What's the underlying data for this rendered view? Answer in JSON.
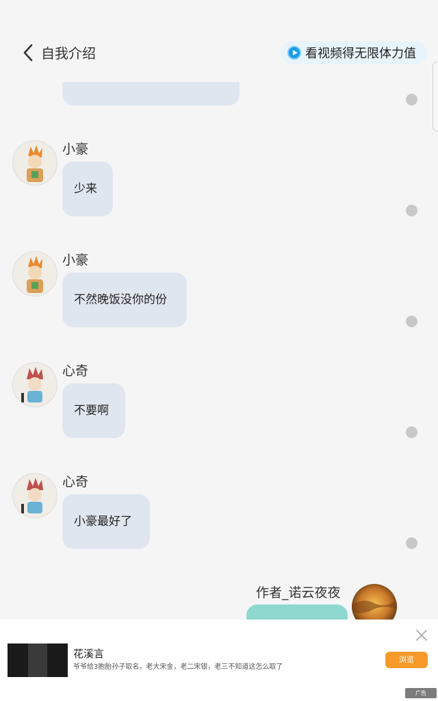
{
  "header": {
    "back_icon": "chevron-left-icon",
    "title": "自我介绍",
    "video_reward_label": "看视频得无限体力值",
    "play_icon": "play-circle-icon"
  },
  "messages": [
    {
      "sender": "小豪",
      "text": "少来",
      "avatar": "xiaohao-avatar"
    },
    {
      "sender": "小豪",
      "text": "不然晚饭没你的份",
      "avatar": "xiaohao-avatar"
    },
    {
      "sender": "心奇",
      "text": "不要啊",
      "avatar": "xinqi-avatar"
    },
    {
      "sender": "心奇",
      "text": "小豪最好了",
      "avatar": "xinqi-avatar"
    }
  ],
  "author": {
    "name": "作者_诺云夜夜",
    "avatar": "author-avatar"
  },
  "ad": {
    "title": "花溪言",
    "description": "爷爷给3胞胎孙子取名，老大宋金，老二宋银，老三不知道这怎么取了",
    "button_label": "浏览",
    "badge_label": "广告",
    "close_icon": "close-icon"
  },
  "colors": {
    "bubble": "#e0e6ef",
    "author_bubble": "#8ed8d0",
    "accent": "#1a9be6",
    "ad_button": "#f79a2a"
  }
}
